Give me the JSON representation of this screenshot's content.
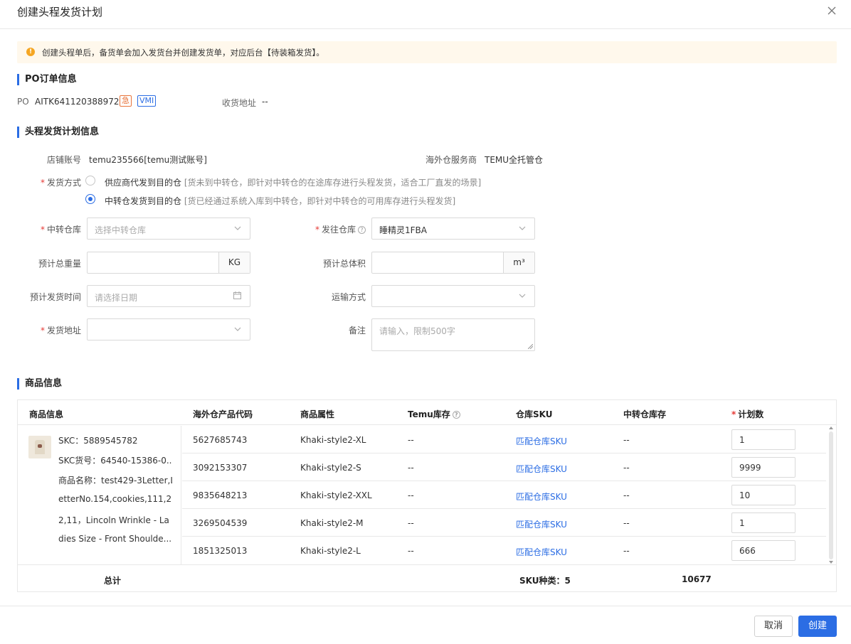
{
  "dialog": {
    "title": "创建头程发货计划"
  },
  "notice": {
    "text": "创建头程单后，备货单会加入发货台并创建发货单，对应后台【待装箱发货】。"
  },
  "po_section": {
    "title": "PO订单信息",
    "po_label": "PO",
    "po_number": "AITK641120388972",
    "tag_urgent": "急",
    "tag_vmi": "VMI",
    "address_label": "收货地址",
    "address_value": "--"
  },
  "plan_section": {
    "title": "头程发货计划信息",
    "store_label": "店铺账号",
    "store_value": "temu235566[temu测试账号]",
    "provider_label": "海外仓服务商",
    "provider_value": "TEMU全托管仓",
    "ship_method_label": "发货方式",
    "ship_options": [
      {
        "label": "供应商代发到目的仓",
        "hint": "[货未到中转仓，即针对中转仓的在途库存进行头程发货，适合工厂直发的场景]"
      },
      {
        "label": "中转仓发货到目的仓",
        "hint": "[货已经通过系统入库到中转仓，即针对中转仓的可用库存进行头程发货]"
      }
    ],
    "transit_wh_label": "中转仓库",
    "transit_wh_placeholder": "选择中转仓库",
    "dest_wh_label": "发往仓库",
    "dest_wh_value": "睡精灵1FBA",
    "weight_label": "预计总重量",
    "weight_unit": "KG",
    "volume_label": "预计总体积",
    "volume_unit": "m³",
    "ship_time_label": "预计发货时间",
    "ship_time_placeholder": "请选择日期",
    "transport_label": "运输方式",
    "ship_addr_label": "发货地址",
    "remark_label": "备注",
    "remark_placeholder": "请输入，限制500字"
  },
  "goods_section": {
    "title": "商品信息",
    "headers": [
      "商品信息",
      "海外仓产品代码",
      "商品属性",
      "Temu库存",
      "仓库SKU",
      "中转仓库存",
      "计划数"
    ],
    "product": {
      "skc": "SKC：5889545782",
      "skc_code": "SKC货号：64540-15386-0...",
      "name_lines": [
        "商品名称：test429-3Letter,L",
        "etterNo.154,cookies,111,22",
        "2,11，Lincoln Wrinkle - La",
        "dies Size - Front Shoulde..."
      ]
    },
    "rows": [
      {
        "code": "5627685743",
        "attr": "Khaki-style2-XL",
        "temu_stock": "--",
        "wh_sku": "匹配仓库SKU",
        "transit_stock": "--",
        "qty": "1"
      },
      {
        "code": "3092153307",
        "attr": "Khaki-style2-S",
        "temu_stock": "--",
        "wh_sku": "匹配仓库SKU",
        "transit_stock": "--",
        "qty": "9999"
      },
      {
        "code": "9835648213",
        "attr": "Khaki-style2-XXL",
        "temu_stock": "--",
        "wh_sku": "匹配仓库SKU",
        "transit_stock": "--",
        "qty": "10"
      },
      {
        "code": "3269504539",
        "attr": "Khaki-style2-M",
        "temu_stock": "--",
        "wh_sku": "匹配仓库SKU",
        "transit_stock": "--",
        "qty": "1"
      },
      {
        "code": "1851325013",
        "attr": "Khaki-style2-L",
        "temu_stock": "--",
        "wh_sku": "匹配仓库SKU",
        "transit_stock": "--",
        "qty": "666"
      }
    ],
    "total_label": "总计",
    "sku_types": "SKU种类：5",
    "total_qty": "10677"
  },
  "actions": {
    "cancel": "取消",
    "create": "创建"
  },
  "colors": {
    "accent": "#2b6de4",
    "warning": "#f5a623",
    "urgent": "#e8743b",
    "notice_bg": "#fff8ec",
    "required": "#e53935"
  }
}
